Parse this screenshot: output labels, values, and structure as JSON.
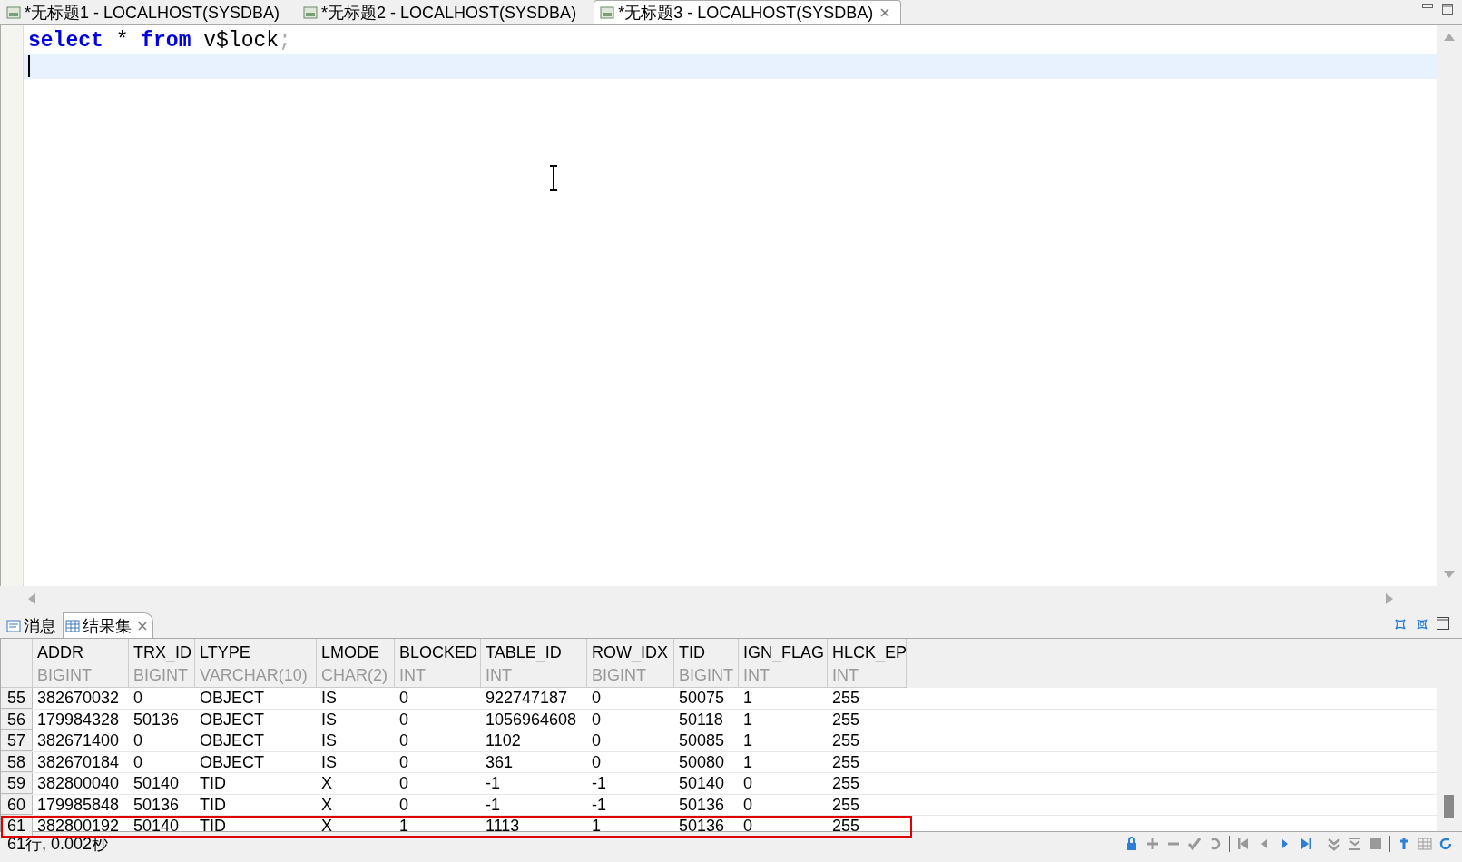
{
  "editor_tabs": [
    {
      "label": "*无标题1 - LOCALHOST(SYSDBA)",
      "selected": false,
      "closable": false
    },
    {
      "label": "*无标题2 - LOCALHOST(SYSDBA)",
      "selected": false,
      "closable": false
    },
    {
      "label": "*无标题3 - LOCALHOST(SYSDBA)",
      "selected": true,
      "closable": true
    }
  ],
  "editor": {
    "lines": [
      {
        "current": false,
        "tokens": [
          {
            "text": "select",
            "kind": "keyword"
          },
          {
            "text": " * ",
            "kind": "plain"
          },
          {
            "text": "from",
            "kind": "keyword"
          },
          {
            "text": " v$lock",
            "kind": "plain"
          },
          {
            "text": ";",
            "kind": "punct"
          }
        ]
      },
      {
        "current": true
      }
    ]
  },
  "result_tabs": [
    {
      "label": "消息",
      "selected": false,
      "kind": "message",
      "closable": false
    },
    {
      "label": "结果集",
      "selected": true,
      "kind": "table",
      "closable": true
    }
  ],
  "table": {
    "columns": [
      {
        "name": "ADDR",
        "type": "BIGINT"
      },
      {
        "name": "TRX_ID",
        "type": "BIGINT"
      },
      {
        "name": "LTYPE",
        "type": "VARCHAR(10)"
      },
      {
        "name": "LMODE",
        "type": "CHAR(2)"
      },
      {
        "name": "BLOCKED",
        "type": "INT"
      },
      {
        "name": "TABLE_ID",
        "type": "INT"
      },
      {
        "name": "ROW_IDX",
        "type": "BIGINT"
      },
      {
        "name": "TID",
        "type": "BIGINT"
      },
      {
        "name": "IGN_FLAG",
        "type": "INT"
      },
      {
        "name": "HLCK_EP",
        "type": "INT"
      }
    ],
    "rows": [
      {
        "num": "55",
        "selected": false,
        "cells": [
          "382670032",
          "0",
          "OBJECT",
          "IS",
          "0",
          "922747187",
          "0",
          "50075",
          "1",
          "255"
        ]
      },
      {
        "num": "56",
        "selected": false,
        "cells": [
          "179984328",
          "50136",
          "OBJECT",
          "IS",
          "0",
          "1056964608",
          "0",
          "50118",
          "1",
          "255"
        ]
      },
      {
        "num": "57",
        "selected": false,
        "cells": [
          "382671400",
          "0",
          "OBJECT",
          "IS",
          "0",
          "1102",
          "0",
          "50085",
          "1",
          "255"
        ]
      },
      {
        "num": "58",
        "selected": false,
        "cells": [
          "382670184",
          "0",
          "OBJECT",
          "IS",
          "0",
          "361",
          "0",
          "50080",
          "1",
          "255"
        ]
      },
      {
        "num": "59",
        "selected": false,
        "cells": [
          "382800040",
          "50140",
          "TID",
          "X",
          "0",
          "-1",
          "-1",
          "50140",
          "0",
          "255"
        ]
      },
      {
        "num": "60",
        "selected": false,
        "cells": [
          "179985848",
          "50136",
          "TID",
          "X",
          "0",
          "-1",
          "-1",
          "50136",
          "0",
          "255"
        ]
      },
      {
        "num": "61",
        "selected": true,
        "cells": [
          "382800192",
          "50140",
          "TID",
          "X",
          "1",
          "1113",
          "1",
          "50136",
          "0",
          "255"
        ]
      }
    ]
  },
  "status_bar": {
    "text": "61行, 0.002秒"
  }
}
